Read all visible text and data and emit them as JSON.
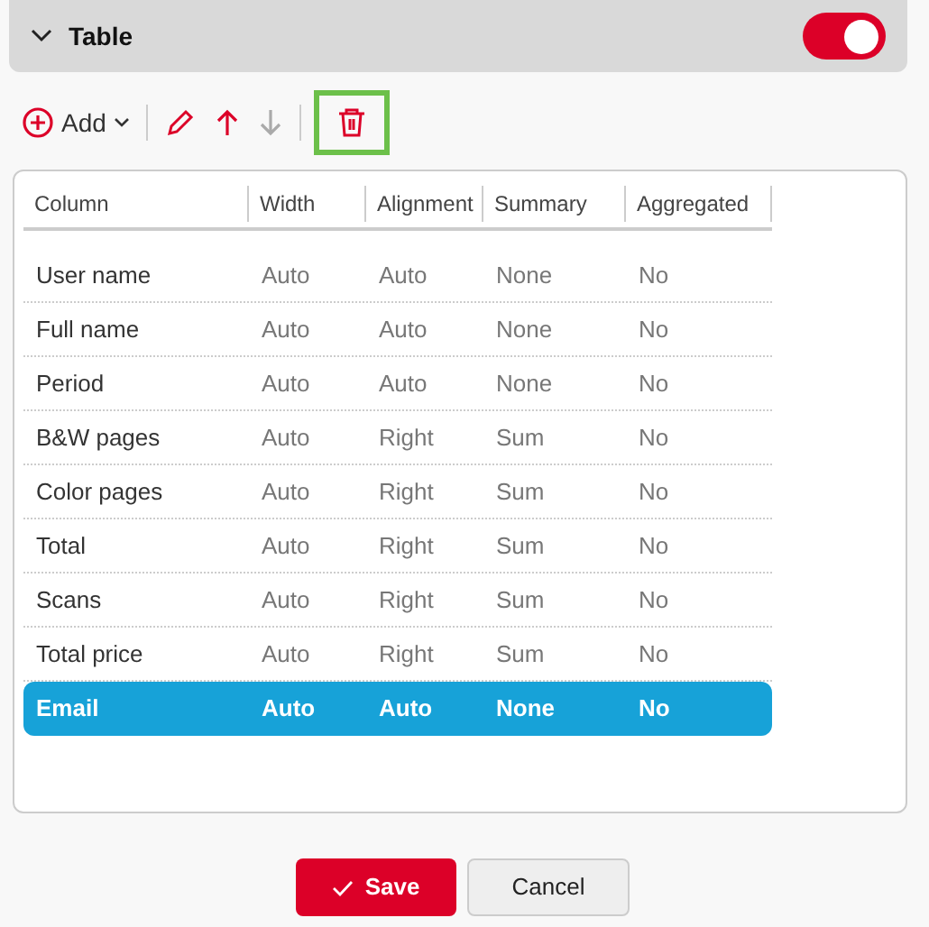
{
  "section": {
    "title": "Table",
    "expanded": true,
    "toggle_on": true
  },
  "toolbar": [
    {
      "kind": "add",
      "label": "Add",
      "disabled": false,
      "highlighted": false
    },
    {
      "kind": "edit",
      "disabled": false,
      "highlighted": false
    },
    {
      "kind": "up",
      "disabled": false,
      "highlighted": false
    },
    {
      "kind": "down",
      "disabled": true,
      "highlighted": false
    },
    {
      "kind": "delete",
      "disabled": false,
      "highlighted": true
    }
  ],
  "table": {
    "columns": [
      "Column",
      "Width",
      "Alignment",
      "Summary",
      "Aggregated"
    ],
    "rows": [
      {
        "cells": [
          "User name",
          "Auto",
          "Auto",
          "None",
          "No"
        ],
        "selected": false
      },
      {
        "cells": [
          "Full name",
          "Auto",
          "Auto",
          "None",
          "No"
        ],
        "selected": false
      },
      {
        "cells": [
          "Period",
          "Auto",
          "Auto",
          "None",
          "No"
        ],
        "selected": false
      },
      {
        "cells": [
          "B&W pages",
          "Auto",
          "Right",
          "Sum",
          "No"
        ],
        "selected": false
      },
      {
        "cells": [
          "Color pages",
          "Auto",
          "Right",
          "Sum",
          "No"
        ],
        "selected": false
      },
      {
        "cells": [
          "Total",
          "Auto",
          "Right",
          "Sum",
          "No"
        ],
        "selected": false
      },
      {
        "cells": [
          "Scans",
          "Auto",
          "Right",
          "Sum",
          "No"
        ],
        "selected": false
      },
      {
        "cells": [
          "Total price",
          "Auto",
          "Right",
          "Sum",
          "No"
        ],
        "selected": false
      },
      {
        "cells": [
          "Email",
          "Auto",
          "Auto",
          "None",
          "No"
        ],
        "selected": true
      }
    ]
  },
  "buttons": [
    {
      "kind": "primary",
      "label": "Save"
    },
    {
      "kind": "secondary",
      "label": "Cancel"
    }
  ]
}
